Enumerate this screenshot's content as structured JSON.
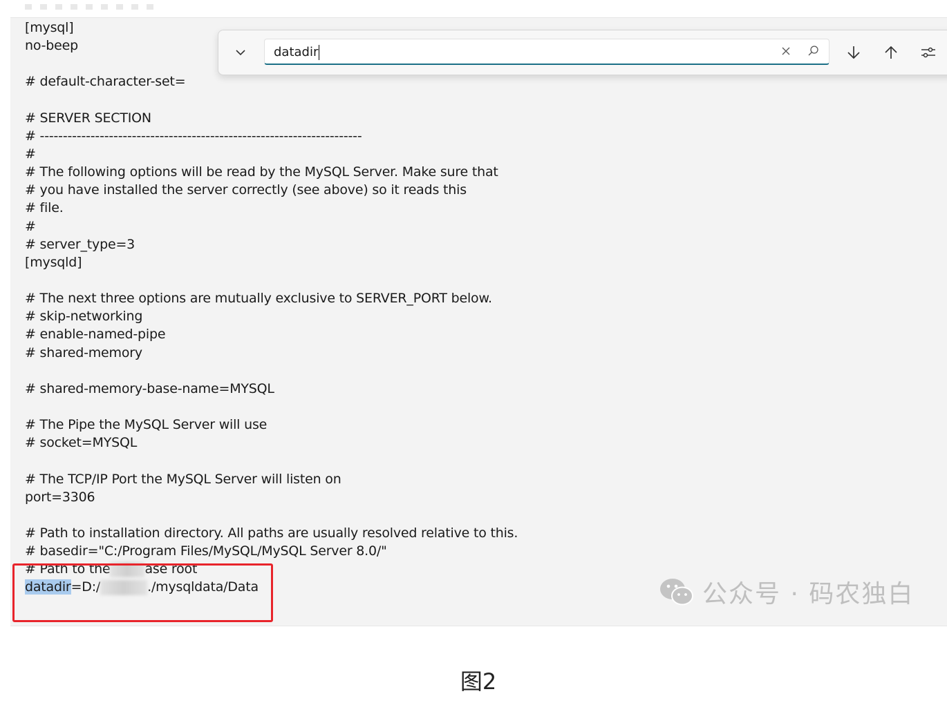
{
  "editor": {
    "lines": [
      "[mysql]",
      "no-beep",
      "",
      "# default-character-set=",
      "",
      "# SERVER SECTION",
      "# ----------------------------------------------------------------------",
      "#",
      "# The following options will be read by the MySQL Server. Make sure that",
      "# you have installed the server correctly (see above) so it reads this",
      "# file.",
      "#",
      "# server_type=3",
      "[mysqld]",
      "",
      "# The next three options are mutually exclusive to SERVER_PORT below.",
      "# skip-networking",
      "# enable-named-pipe",
      "# shared-memory",
      "",
      "# shared-memory-base-name=MYSQL",
      "",
      "# The Pipe the MySQL Server will use",
      "# socket=MYSQL",
      "",
      "# The TCP/IP Port the MySQL Server will listen on",
      "port=3306",
      "",
      "# Path to installation directory. All paths are usually resolved relative to this.",
      "# basedir=\"C:/Program Files/MySQL/MySQL Server 8.0/\""
    ],
    "datadir_comment_pre": "# Path to the",
    "datadir_comment_post": "ase root",
    "datadir_key": "datadir",
    "datadir_eq": "=D:/",
    "datadir_post": "./mysqldata/Data"
  },
  "find": {
    "query": "datadir",
    "icons": [
      "chevron-down-icon",
      "clear-icon",
      "search-icon",
      "arrow-down-icon",
      "arrow-up-icon",
      "options-icon"
    ]
  },
  "watermark": "公众号 · 码农独白",
  "caption": "图2",
  "colors": {
    "highlight": "#a9cbee",
    "redbox": "#e8242b",
    "accent": "#1a6f86",
    "editor_bg": "#f3f3f3"
  }
}
